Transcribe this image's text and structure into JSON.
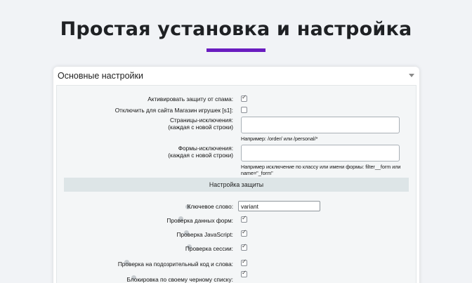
{
  "hero": {
    "title": "Простая установка и настройка"
  },
  "panel": {
    "title": "Основные настройки",
    "rows": {
      "activate_label": "Активировать защиту от спама:",
      "disable_label": "Отключить для сайта Магазин игрушек [s1]:",
      "pages_label_1": "Страницы-исключения:",
      "pages_label_2": "(каждая с новой строки)",
      "pages_hint": "Например: /order/ или /personal/*",
      "forms_label_1": "Формы-исключения:",
      "forms_label_2": "(каждая с новой строки)",
      "forms_hint": "Например исключение по классу или имени формы: filter__form или name=\"_form\""
    },
    "protection": {
      "section_title": "Настройка защиты",
      "keyword_label": "Ключевое слово:",
      "keyword_value": "variant",
      "forms_check_label": "Проверка данных форм:",
      "js_check_label": "Проверка JavaScript:",
      "session_check_label": "Проверка сессии:",
      "suspicious_label": "Проверка на подозрительный код и слова:",
      "blacklist_label": "Блокировка по своему черному списку:"
    },
    "checkboxes": {
      "activate": true,
      "disable": false,
      "forms_check": true,
      "js_check": true,
      "session_check": true,
      "suspicious": true,
      "blacklist": true
    }
  },
  "colors": {
    "accent": "#6a1cc0",
    "section_bg": "#dde5e7",
    "page_bg": "#f1f3f6"
  }
}
